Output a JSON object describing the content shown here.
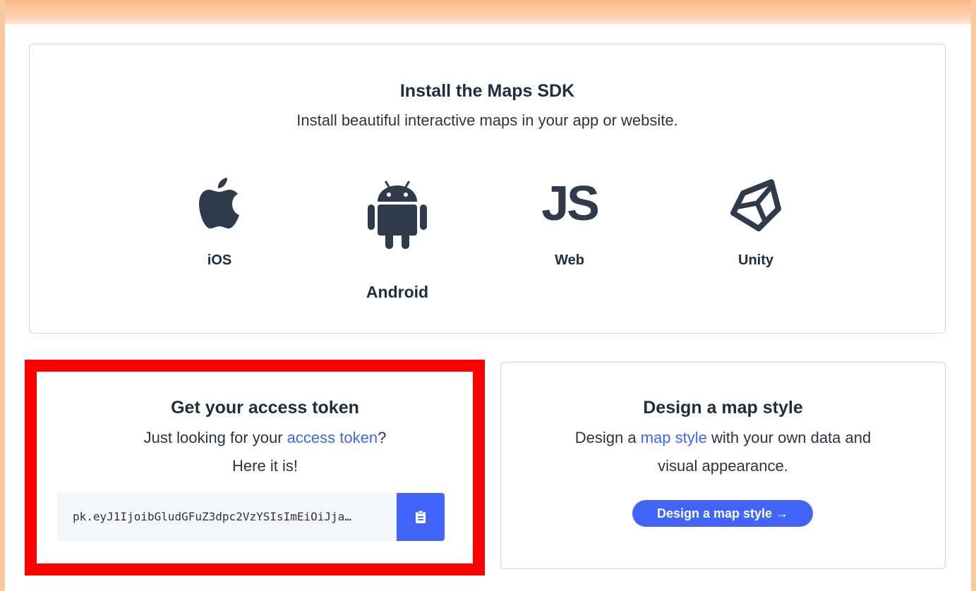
{
  "sdk": {
    "title": "Install the Maps SDK",
    "subtitle": "Install beautiful interactive maps in your app or website.",
    "platforms": [
      {
        "label": "iOS",
        "icon": "apple-icon"
      },
      {
        "label": "Android",
        "icon": "android-icon"
      },
      {
        "label": "Web",
        "icon": "js-icon"
      },
      {
        "label": "Unity",
        "icon": "unity-icon"
      }
    ],
    "js_glyph": "JS"
  },
  "token": {
    "title": "Get your access token",
    "text_prefix": "Just looking for your ",
    "link": "access token",
    "text_suffix": "?",
    "line2": "Here it is!",
    "value": "pk.eyJ1IjoibGludGFuZ3dpc2VzYSIsImEiOiJja…",
    "copy_icon": "clipboard-icon"
  },
  "design": {
    "title": "Design a map style",
    "text_prefix": "Design a ",
    "link": "map style",
    "text_suffix": " with your own data and",
    "line2": "visual appearance.",
    "button_label": "Design a map style →"
  },
  "colors": {
    "accent": "#4264fb",
    "highlight": "#ff0000",
    "frame": "#fbc9a0"
  }
}
